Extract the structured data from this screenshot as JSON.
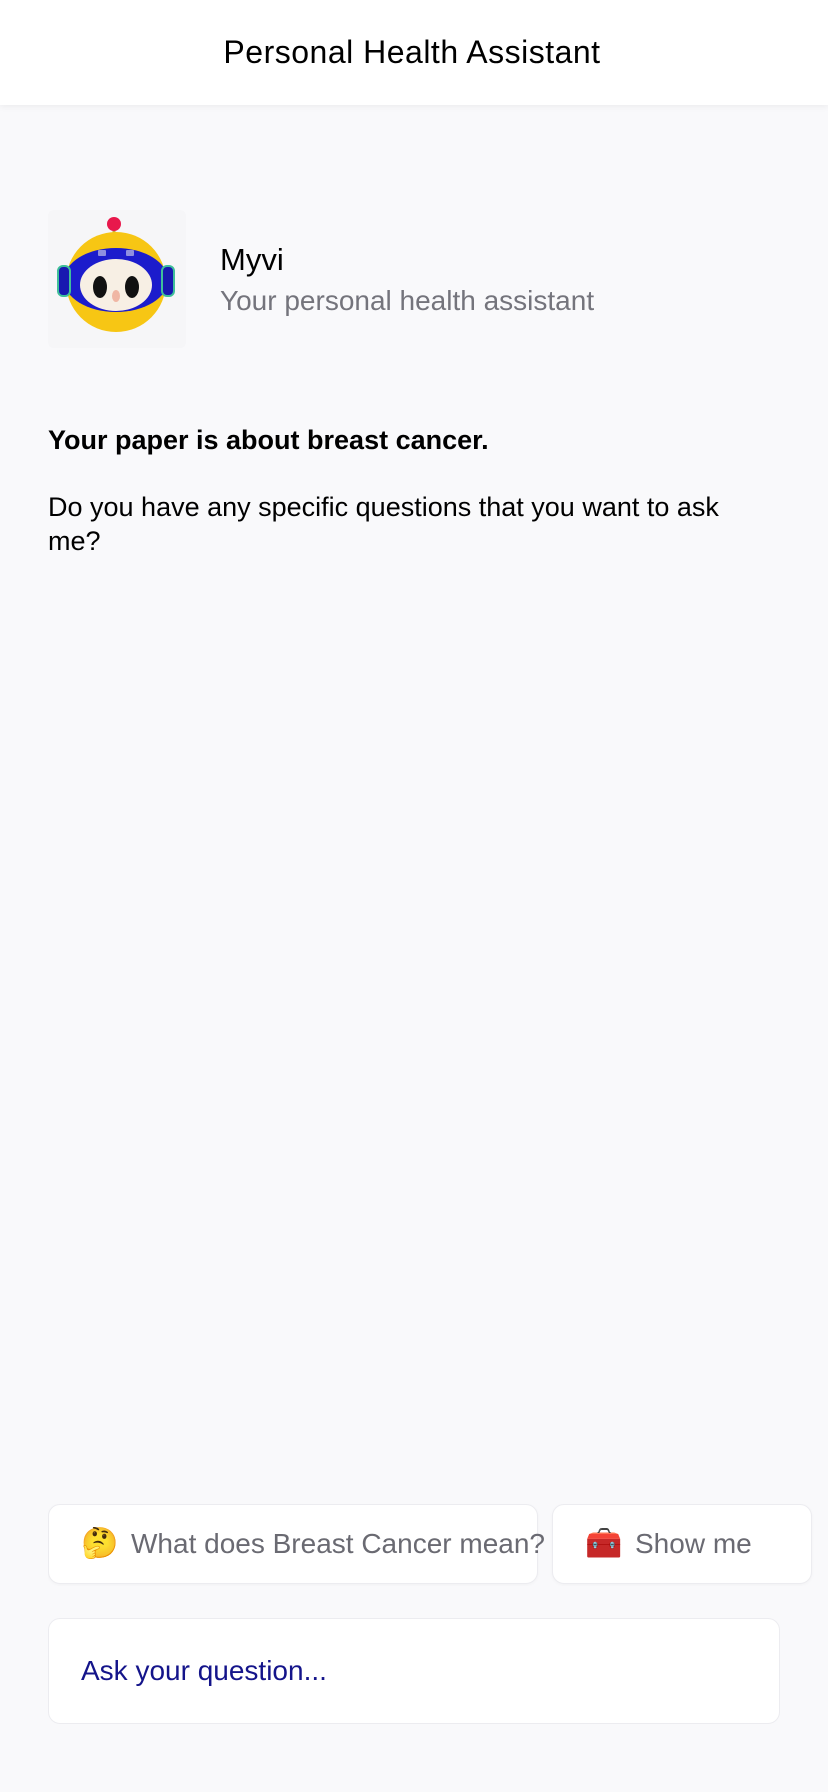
{
  "header": {
    "title": "Personal Health Assistant"
  },
  "assistant": {
    "name": "Myvi",
    "subtitle": "Your personal health assistant",
    "avatar_icon": "robot-mascot-icon"
  },
  "message": {
    "headline": "Your paper is about breast cancer.",
    "body": "Do you have any specific questions that you want to ask me?"
  },
  "suggestions": [
    {
      "emoji": "🤔",
      "icon": "thinking-face-icon",
      "label": "What does Breast Cancer mean?"
    },
    {
      "emoji": "🧰",
      "icon": "toolbox-icon",
      "label": "Show me"
    }
  ],
  "input": {
    "placeholder": "Ask your question..."
  },
  "colors": {
    "background": "#f9f9fb",
    "header_bg": "#ffffff",
    "subtitle": "#74747c",
    "placeholder": "#14148a",
    "avatar_yellow": "#f7c614",
    "avatar_blue": "#1c1ccc"
  }
}
